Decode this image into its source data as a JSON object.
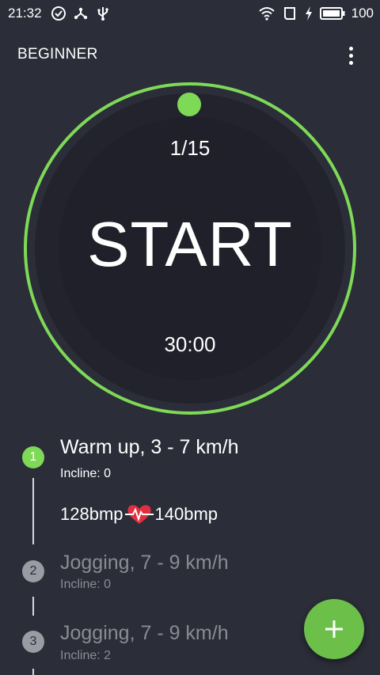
{
  "status_bar": {
    "time": "21:32",
    "battery_level": "100",
    "left_icons": [
      "check-circle-icon",
      "share-network-icon",
      "usb-icon"
    ],
    "right_icons": [
      "wifi-icon",
      "sim-card-icon",
      "charging-icon",
      "battery-icon"
    ]
  },
  "appbar": {
    "title": "BEGINNER",
    "menu_icon": "more-vert-icon"
  },
  "timer": {
    "progress": "1/15",
    "start_label": "START",
    "total_time": "30:00",
    "ring_color": "#7ed957"
  },
  "steps": [
    {
      "number": "1",
      "title": "Warm up, 3 - 7 km/h",
      "incline": "Incline: 0",
      "state": "active"
    },
    {
      "number": "2",
      "title": "Jogging, 7 - 9 km/h",
      "incline": "Incline: 0",
      "state": "idle"
    },
    {
      "number": "3",
      "title": "Jogging, 7 - 9 km/h",
      "incline": "Incline: 2",
      "state": "idle"
    }
  ],
  "heart_rate": {
    "min": "128bmp",
    "max": "140bmp",
    "icon": "heart-pulse-icon"
  },
  "fab": {
    "icon": "plus-icon",
    "color": "#6cc04a"
  },
  "colors": {
    "background": "#2b2d38",
    "accent": "#7ed957",
    "inactive_text": "#8a8b93"
  }
}
